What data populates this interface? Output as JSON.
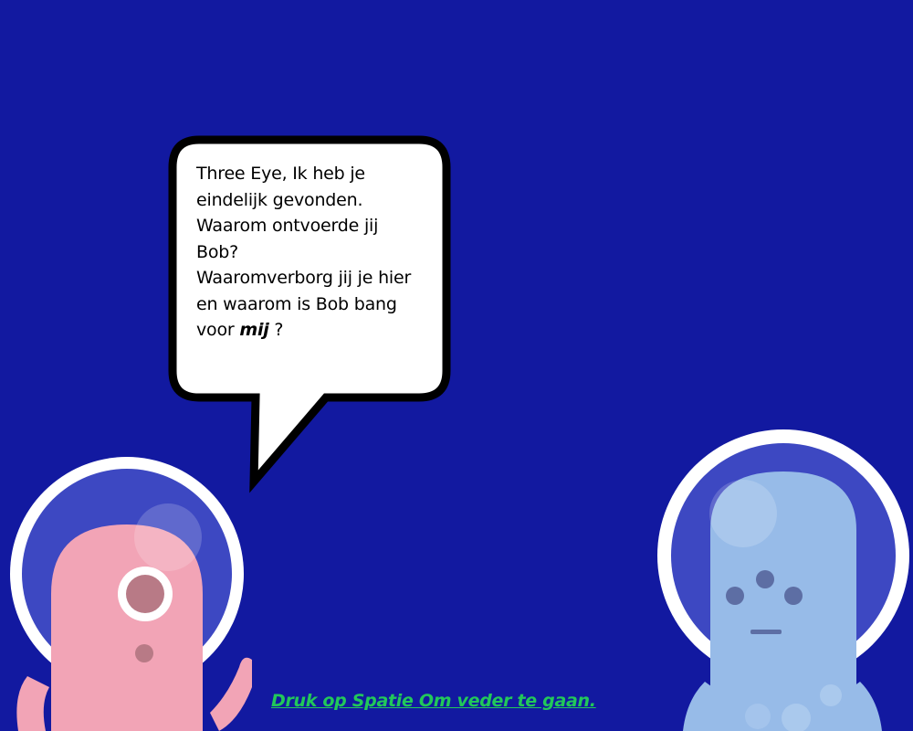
{
  "scene": {
    "background_color": "#1219a0"
  },
  "dialogue": {
    "lines": [
      "Three Eye, Ik heb je",
      "eindelijk gevonden.",
      "Waarom ontvoerde jij",
      "Bob?",
      "Waaromverborg jij je hier",
      "en waarom is Bob bang"
    ],
    "last_line_prefix": "voor ",
    "last_line_emphasis": "mij",
    "last_line_suffix": " ?"
  },
  "characters": {
    "speaker": {
      "body_color": "#f2a4b6",
      "eye_color": "#b87a86",
      "mouth_color": "#b87a86",
      "helmet_inner_color": "#3d48c2",
      "helmet_rim_color": "#ffffff"
    },
    "listener": {
      "body_color": "#97bbe8",
      "eye_color": "#5d6ea4",
      "mouth_color": "#5d6ea4",
      "helmet_inner_color": "#3d48c2",
      "helmet_rim_color": "#ffffff"
    }
  },
  "prompt": {
    "continue_text": "Druk op Spatie Om veder te gaan.",
    "color": "#22c85a"
  }
}
